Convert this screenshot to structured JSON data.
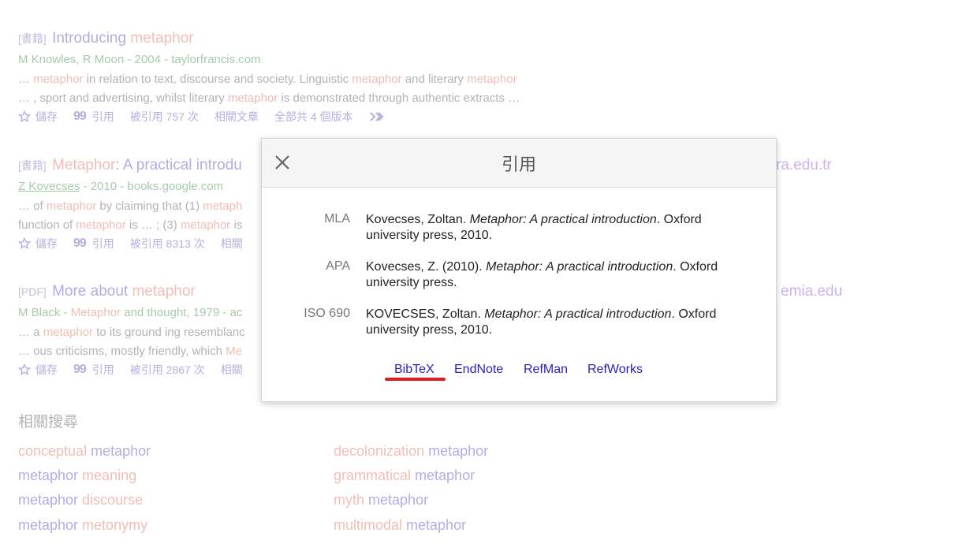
{
  "results": [
    {
      "tag": "[書籍]",
      "title_hl": "",
      "title_pre": "Introducing ",
      "title_hl2": "metaphor",
      "right_domain": "",
      "authors": "M Knowles, R Moon - 2004 - taylorfrancis.com",
      "snippet1": [
        "… ",
        "metaphor",
        " in relation to text, discourse and society. Linguistic ",
        "metaphor",
        " and literary ",
        "metaphor"
      ],
      "snippet2": [
        "… , sport and advertising, whilst literary ",
        "metaphor",
        " is demonstrated through authentic extracts …"
      ],
      "save": "儲存",
      "cite": "引用",
      "cited_by": "被引用 757 次",
      "related": "相關文章",
      "versions": "全部共 4 個版本"
    },
    {
      "tag": "[書籍]",
      "title_hl": "Metaphor",
      "title_pre": ": A practical introdu",
      "right_domain": "ra.edu.tr",
      "authors_u": "Z Kovecses",
      "authors_rest": " - 2010 - books.google.com",
      "snippet1": [
        "… of ",
        "metaphor",
        " by claiming that (1) ",
        "metaph"
      ],
      "snippet2": [
        "function of ",
        "metaphor",
        " is … ; (3) ",
        "metaphor",
        " is"
      ],
      "save": "儲存",
      "cite": "引用",
      "cited_by": "被引用 8313 次",
      "related": "相關"
    },
    {
      "tag": "[PDF]",
      "title_pre": "More about ",
      "title_hl2": "metaphor",
      "right_domain": "emia.edu",
      "authors_a": "M Black - ",
      "authors_hl": "Metaphor",
      "authors_b": " and thought, 1979 - ac",
      "snippet1": [
        "… a ",
        "metaphor",
        " to its ground ing resemblanc"
      ],
      "snippet2": [
        "… ous criticisms, mostly friendly, which ",
        "Me"
      ],
      "save": "儲存",
      "cite": "引用",
      "cited_by": "被引用 2867 次",
      "related": "相關"
    }
  ],
  "related_searches": {
    "heading": "相關搜尋",
    "left": [
      {
        "a": "conceptual",
        "b": " metaphor",
        "hl_first": true
      },
      {
        "a": "metaphor",
        "b": " meaning",
        "hl_first": false
      },
      {
        "a": "metaphor",
        "b": " discourse",
        "hl_first": false
      },
      {
        "a": "metaphor",
        "b": " metonymy",
        "hl_first": false
      }
    ],
    "right": [
      {
        "a": "decolonization",
        "b": " metaphor",
        "hl_first": true
      },
      {
        "a": "grammatical",
        "b": " metaphor",
        "hl_first": true
      },
      {
        "a": "myth",
        "b": " metaphor",
        "hl_first": true
      },
      {
        "a": "multimodal",
        "b": " metaphor",
        "hl_first": true
      }
    ]
  },
  "modal": {
    "title": "引用",
    "citations": [
      {
        "label": "MLA",
        "pre": "Kovecses, Zoltan. ",
        "italic": "Metaphor: A practical introduction",
        "post": ". Oxford university press, 2010."
      },
      {
        "label": "APA",
        "pre": "Kovecses, Z. (2010). ",
        "italic": "Metaphor: A practical introduction",
        "post": ". Oxford university press."
      },
      {
        "label": "ISO 690",
        "pre": "KOVECSES, Zoltan. ",
        "italic": "Metaphor: A practical introduction",
        "post": ". Oxford university press, 2010."
      }
    ],
    "exports": {
      "bibtex": "BibTeX",
      "endnote": "EndNote",
      "refman": "RefMan",
      "refworks": "RefWorks"
    }
  },
  "colors": {
    "title": "#8c80d6",
    "highlight": "#ea9b8e",
    "authors": "#76b07a",
    "snippet": "#8a8a8a",
    "export_link": "#2a1fb8",
    "annotation": "#e01d1d"
  }
}
